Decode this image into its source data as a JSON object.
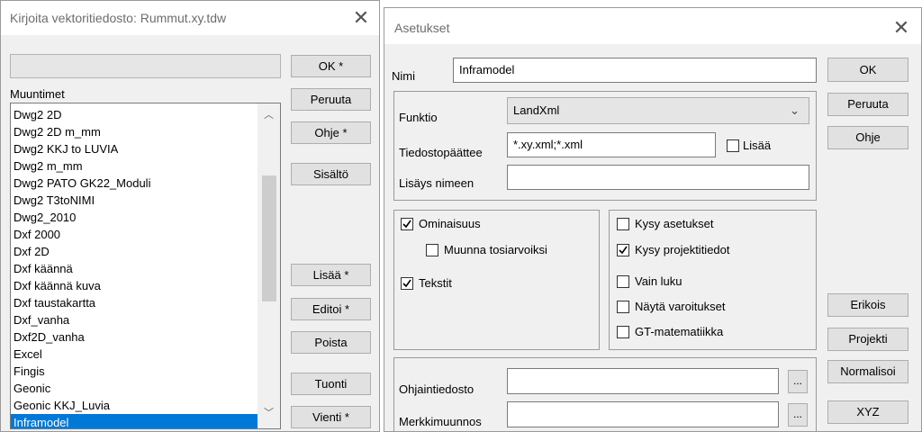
{
  "left": {
    "title": "Kirjoita vektoritiedosto: Rummut.xy.tdw",
    "close": "✕",
    "status_value": "",
    "list_label": "Muuntimet",
    "items": [
      "Dwg2 2D",
      "Dwg2 2D m_mm",
      "Dwg2 KKJ to LUVIA",
      "Dwg2 m_mm",
      "Dwg2 PATO GK22_Moduli",
      "Dwg2 T3toNIMI",
      "Dwg2_2010",
      "Dxf 2000",
      "Dxf 2D",
      "Dxf käännä",
      "Dxf käännä kuva",
      "Dxf taustakartta",
      "Dxf_vanha",
      "Dxf2D_vanha",
      "Excel",
      "Fingis",
      "Geonic",
      "Geonic KKJ_Luvia",
      "Inframodel"
    ],
    "buttons": {
      "ok": "OK *",
      "peruuta": "Peruuta",
      "ohje": "Ohje *",
      "sisalto": "Sisältö",
      "lisaa": "Lisää *",
      "editoi": "Editoi *",
      "poista": "Poista",
      "tuonti": "Tuonti",
      "vienti": "Vienti *"
    }
  },
  "right": {
    "title": "Asetukset",
    "close": "✕",
    "nimi_label": "Nimi",
    "nimi_value": "Inframodel",
    "funktio_label": "Funktio",
    "funktio_value": "LandXml",
    "tiedostopaate_label": "Tiedostopäättee",
    "tiedostopaate_value": "*.xy.xml;*.xml",
    "lisaa_label": "Lisää",
    "lisays_label": "Lisäys nimeen",
    "lisays_value": "",
    "ominaisuus_label": "Ominaisuus",
    "muunna_label": "Muunna tosiarvoiksi",
    "tekstit_label": "Tekstit",
    "kysy_asetukset_label": "Kysy asetukset",
    "kysy_projekti_label": "Kysy projektitiedot",
    "vain_luku_label": "Vain luku",
    "nayta_label": "Näytä varoitukset",
    "gt_label": "GT-matematiikka",
    "ohjaus_label": "Ohjaintiedosto",
    "merkki_label": "Merkkimuunnos",
    "ellipsis": "...",
    "buttons": {
      "ok": "OK",
      "peruuta": "Peruuta",
      "ohje": "Ohje",
      "erikois": "Erikois",
      "projekti": "Projekti",
      "normalisoi": "Normalisoi",
      "xyz": "XYZ"
    }
  }
}
